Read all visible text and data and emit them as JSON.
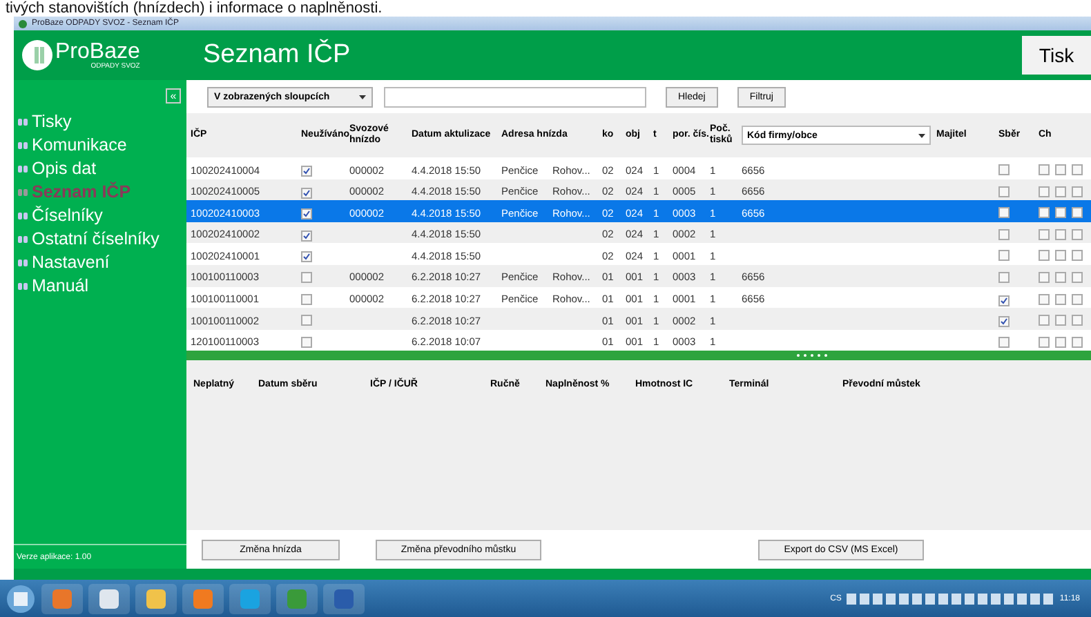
{
  "slide_heading": "tivých stanovištích (hnízdech) i informace o naplněnosti.",
  "window": {
    "title": "ProBaze ODPADY SVOZ - Seznam IČP"
  },
  "logo": {
    "name": "ProBaze",
    "subtitle": "ODPADY SVOZ"
  },
  "header": {
    "title": "Seznam IČP",
    "print_button": "Tisk"
  },
  "sidebar": {
    "collapse_button": "«",
    "items": [
      {
        "label": "Tisky",
        "selected": false
      },
      {
        "label": "Komunikace",
        "selected": false
      },
      {
        "label": "Opis dat",
        "selected": false
      },
      {
        "label": "Seznam IČP",
        "selected": true
      },
      {
        "label": "Číselníky",
        "selected": false
      },
      {
        "label": "Ostatní číselníky",
        "selected": false
      },
      {
        "label": "Nastavení",
        "selected": false
      },
      {
        "label": "Manuál",
        "selected": false
      }
    ],
    "version": "Verze aplikace: 1.00"
  },
  "toolbar": {
    "scope_select": "V zobrazených sloupcích",
    "search_button": "Hledej",
    "filter_button": "Filtruj"
  },
  "table": {
    "columns": [
      "IČP",
      "Neužíváno",
      "Svozové hnízdo",
      "Datum aktulizace",
      "Adresa hnízda",
      "ko",
      "obj",
      "t",
      "por. čís.",
      "Poč. tisků",
      "Kód firmy/obce",
      "Majitel",
      "Sběr",
      "Ch"
    ],
    "rows": [
      {
        "icp": "100202410004",
        "neuzivano": true,
        "hnizdo": "000002",
        "datum": "4.4.2018 15:50",
        "adresa_1": "Penčice",
        "adresa_2": "Rohov...",
        "ko": "02",
        "obj": "024",
        "t": "1",
        "por": "0004",
        "poc": "1",
        "kod": "6656",
        "sber": false,
        "ch": [
          false,
          false,
          false
        ],
        "selected": false
      },
      {
        "icp": "100202410005",
        "neuzivano": true,
        "hnizdo": "000002",
        "datum": "4.4.2018 15:50",
        "adresa_1": "Penčice",
        "adresa_2": "Rohov...",
        "ko": "02",
        "obj": "024",
        "t": "1",
        "por": "0005",
        "poc": "1",
        "kod": "6656",
        "sber": false,
        "ch": [
          false,
          false,
          false
        ],
        "selected": false
      },
      {
        "icp": "100202410003",
        "neuzivano": true,
        "hnizdo": "000002",
        "datum": "4.4.2018 15:50",
        "adresa_1": "Penčice",
        "adresa_2": "Rohov...",
        "ko": "02",
        "obj": "024",
        "t": "1",
        "por": "0003",
        "poc": "1",
        "kod": "6656",
        "sber": false,
        "ch": [
          false,
          false,
          false
        ],
        "selected": true
      },
      {
        "icp": "100202410002",
        "neuzivano": true,
        "datum": "4.4.2018 15:50",
        "ko": "02",
        "obj": "024",
        "t": "1",
        "por": "0002",
        "poc": "1",
        "sber": false,
        "ch": [
          false,
          false,
          false
        ],
        "selected": false
      },
      {
        "icp": "100202410001",
        "neuzivano": true,
        "datum": "4.4.2018 15:50",
        "ko": "02",
        "obj": "024",
        "t": "1",
        "por": "0001",
        "poc": "1",
        "sber": false,
        "ch": [
          false,
          false,
          false
        ],
        "selected": false
      },
      {
        "icp": "100100110003",
        "neuzivano": false,
        "hnizdo": "000002",
        "datum": "6.2.2018 10:27",
        "adresa_1": "Penčice",
        "adresa_2": "Rohov...",
        "ko": "01",
        "obj": "001",
        "t": "1",
        "por": "0003",
        "poc": "1",
        "kod": "6656",
        "sber": false,
        "ch": [
          false,
          false,
          false
        ],
        "selected": false
      },
      {
        "icp": "100100110001",
        "neuzivano": false,
        "hnizdo": "000002",
        "datum": "6.2.2018 10:27",
        "adresa_1": "Penčice",
        "adresa_2": "Rohov...",
        "ko": "01",
        "obj": "001",
        "t": "1",
        "por": "0001",
        "poc": "1",
        "kod": "6656",
        "sber": true,
        "ch": [
          false,
          false,
          false
        ],
        "selected": false
      },
      {
        "icp": "100100110002",
        "neuzivano": false,
        "datum": "6.2.2018 10:27",
        "ko": "01",
        "obj": "001",
        "t": "1",
        "por": "0002",
        "poc": "1",
        "sber": true,
        "ch": [
          false,
          false,
          false
        ],
        "selected": false
      },
      {
        "icp": "120100110003",
        "neuzivano": false,
        "datum": "6.2.2018 10:07",
        "ko": "01",
        "obj": "001",
        "t": "1",
        "por": "0003",
        "poc": "1",
        "sber": false,
        "ch": [
          false,
          false,
          false
        ],
        "selected": false
      }
    ]
  },
  "detail_table": {
    "columns": [
      "Neplatný",
      "Datum sběru",
      "IČP / IČUŘ",
      "Ručně",
      "Naplněnost %",
      "Hmotnost IC",
      "Terminál",
      "Převodní můstek"
    ]
  },
  "buttons": [
    "Změna hnízda",
    "Změna převodního můstku",
    "Export do CSV (MS Excel)"
  ],
  "taskbar": {
    "language": "CS",
    "clock": "11:18"
  }
}
